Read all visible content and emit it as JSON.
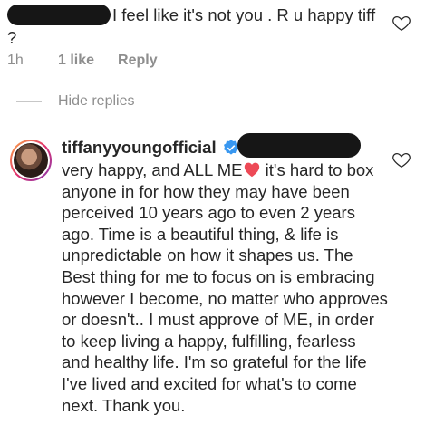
{
  "comment": {
    "text": "I feel like it's not you . R u happy tiff ?",
    "time": "1h",
    "likes": "1 like",
    "reply_label": "Reply"
  },
  "hide_replies_label": "Hide replies",
  "reply": {
    "username": "tiffanyyoungofficial",
    "text_before_heart": "very happy, and ALL ME",
    "text_after_heart": " it's hard to box anyone in for how they may have been perceived 10 years ago to even 2 years ago. Time is a beautiful thing, & life is unpredictable on how it shapes us. The Best thing for me to focus on is embracing however I become, no matter who approves or doesn't.. I must approve of ME, in order to keep living a happy, fulfilling, fearless and healthy life. I'm so grateful for the life I've lived and excited for what's to come next. Thank you."
  },
  "icons": {
    "like": "heart-outline-icon",
    "verified": "verified-badge-icon",
    "emoji": "red-heart-icon"
  },
  "colors": {
    "text": "#262626",
    "secondary": "#8e8e8e",
    "verified": "#3897f0",
    "heart": "#ed4956"
  }
}
